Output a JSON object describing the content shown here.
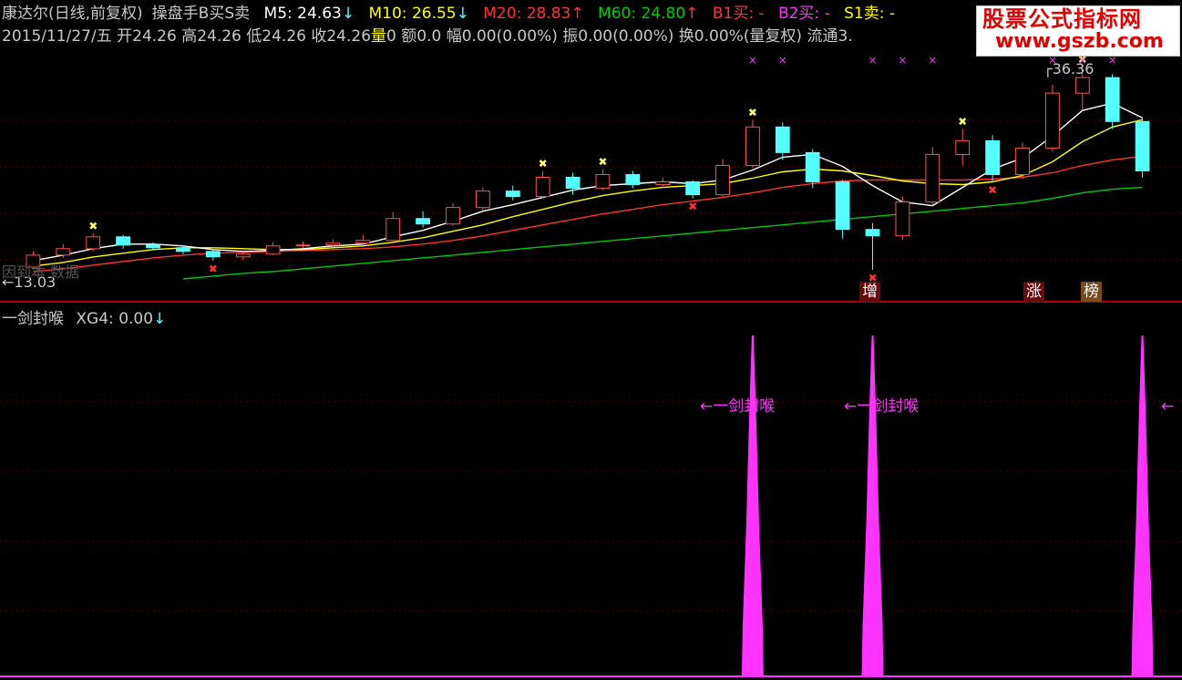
{
  "header": {
    "stock_name": "康达尔(日线,前复权)",
    "indicator_name": "操盘手B买S卖",
    "m5": {
      "label": "M5:",
      "value": "24.63",
      "arrow": "↓"
    },
    "m10": {
      "label": "M10:",
      "value": "26.55",
      "arrow": "↓"
    },
    "m20": {
      "label": "M20:",
      "value": "28.83",
      "arrow": "↑"
    },
    "m60": {
      "label": "M60:",
      "value": "24.80",
      "arrow": "↑"
    },
    "b1": "B1买: -",
    "b2": "B2买: -",
    "s1": "S1卖: -"
  },
  "info_line": {
    "date": "2015/11/27/五",
    "open": "开24.26",
    "high": "高24.26",
    "low": "低24.26",
    "close": "收24.26",
    "volume_label": "量",
    "volume_value": "0",
    "amount": "额0.0",
    "amplitude_pct": "幅0.00(0.00%)",
    "swing": "振0.00(0.00%)",
    "turnover": "换0.00%(量复权)",
    "float": "流通3."
  },
  "price_labels": {
    "high_value": "36.36",
    "low_value": "13.03",
    "low_arrow": "←",
    "faded_text": "因到本 数据"
  },
  "badges": {
    "zeng": "增",
    "zhang": "涨",
    "bang": "榜"
  },
  "indicator": {
    "title": "一剑封喉",
    "xg4_label": "XG4:",
    "xg4_value": "0.00",
    "xg4_arrow": "↓",
    "annotation": "←一剑封喉",
    "annotation_arrow": "←"
  },
  "watermark": {
    "line1": "股票公式指标网",
    "line2": "www.gszb.com"
  },
  "colors": {
    "m5": "#ffffff",
    "m10": "#ffff00",
    "m20": "#ff3333",
    "m60": "#00cc00",
    "b2": "#ff33ff",
    "up_candle": "#ff5050",
    "down_candle": "#54ffff",
    "signal": "#ff33ff",
    "grid": "#8b0000"
  },
  "chart_data": {
    "type": "line",
    "x_count": 38,
    "candles": [
      {
        "o": 14.5,
        "c": 15.8,
        "h": 16.2,
        "l": 14.2
      },
      {
        "o": 15.8,
        "c": 16.5,
        "h": 17.0,
        "l": 15.5
      },
      {
        "o": 16.5,
        "c": 17.8,
        "h": 18.2,
        "l": 16.2
      },
      {
        "o": 17.8,
        "c": 16.9,
        "h": 18.0,
        "l": 16.5
      },
      {
        "o": 16.9,
        "c": 16.6,
        "h": 17.2,
        "l": 16.3
      },
      {
        "o": 16.6,
        "c": 16.2,
        "h": 16.9,
        "l": 15.9
      },
      {
        "o": 16.2,
        "c": 15.6,
        "h": 16.4,
        "l": 15.2
      },
      {
        "o": 15.6,
        "c": 15.9,
        "h": 16.2,
        "l": 15.3
      },
      {
        "o": 15.9,
        "c": 16.8,
        "h": 17.2,
        "l": 15.8
      },
      {
        "o": 16.8,
        "c": 16.9,
        "h": 17.3,
        "l": 16.6
      },
      {
        "o": 16.9,
        "c": 17.1,
        "h": 17.5,
        "l": 16.7
      },
      {
        "o": 17.1,
        "c": 17.4,
        "h": 18.0,
        "l": 17.0
      },
      {
        "o": 17.4,
        "c": 19.8,
        "h": 20.5,
        "l": 17.3
      },
      {
        "o": 19.8,
        "c": 19.2,
        "h": 20.6,
        "l": 18.8
      },
      {
        "o": 19.2,
        "c": 21.0,
        "h": 21.5,
        "l": 19.0
      },
      {
        "o": 21.0,
        "c": 22.8,
        "h": 23.2,
        "l": 20.6
      },
      {
        "o": 22.8,
        "c": 22.2,
        "h": 23.4,
        "l": 21.8
      },
      {
        "o": 22.2,
        "c": 24.3,
        "h": 25.0,
        "l": 22.0
      },
      {
        "o": 24.3,
        "c": 23.1,
        "h": 24.8,
        "l": 22.4
      },
      {
        "o": 23.1,
        "c": 24.6,
        "h": 25.2,
        "l": 22.9
      },
      {
        "o": 24.6,
        "c": 23.5,
        "h": 25.0,
        "l": 23.1
      },
      {
        "o": 23.5,
        "c": 23.8,
        "h": 24.3,
        "l": 23.2
      },
      {
        "o": 23.8,
        "c": 22.4,
        "h": 24.0,
        "l": 22.0
      },
      {
        "o": 22.4,
        "c": 25.6,
        "h": 26.3,
        "l": 22.2
      },
      {
        "o": 25.6,
        "c": 29.8,
        "h": 30.6,
        "l": 25.3
      },
      {
        "o": 29.8,
        "c": 27.0,
        "h": 30.3,
        "l": 26.2
      },
      {
        "o": 27.0,
        "c": 23.8,
        "h": 27.4,
        "l": 23.1
      },
      {
        "o": 23.8,
        "c": 18.6,
        "h": 24.0,
        "l": 17.6
      },
      {
        "o": 18.6,
        "c": 17.9,
        "h": 19.3,
        "l": 14.2
      },
      {
        "o": 17.9,
        "c": 21.6,
        "h": 22.2,
        "l": 17.5
      },
      {
        "o": 21.6,
        "c": 26.8,
        "h": 27.6,
        "l": 21.2
      },
      {
        "o": 26.8,
        "c": 28.3,
        "h": 29.6,
        "l": 25.6
      },
      {
        "o": 28.3,
        "c": 24.6,
        "h": 28.9,
        "l": 23.8
      },
      {
        "o": 24.6,
        "c": 27.5,
        "h": 28.1,
        "l": 24.2
      },
      {
        "o": 27.5,
        "c": 33.5,
        "h": 34.4,
        "l": 27.1
      },
      {
        "o": 33.5,
        "c": 35.2,
        "h": 36.36,
        "l": 31.6
      },
      {
        "o": 35.2,
        "c": 30.4,
        "h": 35.6,
        "l": 29.6
      },
      {
        "o": 30.4,
        "c": 25.0,
        "h": 30.8,
        "l": 24.26
      }
    ],
    "m5": [
      15.2,
      15.8,
      16.5,
      17.0,
      17.0,
      16.8,
      16.4,
      16.2,
      16.3,
      16.5,
      16.8,
      17.0,
      17.8,
      18.5,
      19.5,
      20.6,
      21.3,
      22.1,
      22.9,
      23.4,
      23.6,
      23.8,
      23.6,
      24.0,
      25.1,
      26.5,
      26.8,
      25.5,
      23.4,
      21.6,
      21.2,
      23.2,
      25.2,
      26.4,
      28.8,
      31.6,
      32.4,
      30.8
    ],
    "m10": [
      14.6,
      15.0,
      15.6,
      16.0,
      16.4,
      16.6,
      16.6,
      16.5,
      16.4,
      16.4,
      16.6,
      16.8,
      17.2,
      17.7,
      18.4,
      19.1,
      20.0,
      20.8,
      21.6,
      22.3,
      22.8,
      23.2,
      23.4,
      23.6,
      24.2,
      24.9,
      25.2,
      25.0,
      24.5,
      23.9,
      23.6,
      23.5,
      23.8,
      24.5,
      26.0,
      28.2,
      29.8,
      30.6
    ],
    "m20": [
      14.0,
      14.3,
      14.7,
      15.1,
      15.5,
      15.8,
      16.0,
      16.1,
      16.2,
      16.3,
      16.4,
      16.5,
      16.7,
      17.0,
      17.4,
      17.9,
      18.5,
      19.1,
      19.7,
      20.3,
      20.8,
      21.3,
      21.7,
      22.1,
      22.6,
      23.2,
      23.6,
      23.9,
      24.0,
      24.0,
      24.0,
      24.0,
      24.1,
      24.3,
      24.8,
      25.6,
      26.2,
      26.6
    ],
    "m60": [
      null,
      null,
      null,
      null,
      null,
      13.2,
      13.5,
      13.8,
      14.0,
      14.3,
      14.6,
      14.9,
      15.2,
      15.5,
      15.8,
      16.1,
      16.4,
      16.7,
      17.0,
      17.3,
      17.6,
      17.9,
      18.2,
      18.5,
      18.8,
      19.1,
      19.4,
      19.7,
      20.0,
      20.3,
      20.6,
      20.9,
      21.2,
      21.5,
      22.0,
      22.6,
      23.0,
      23.2
    ],
    "signal_bars": [
      {
        "index": 24,
        "value": 1
      },
      {
        "index": 28,
        "value": 1
      },
      {
        "index": 37,
        "value": 1
      }
    ],
    "ylim": [
      12.0,
      37.5
    ],
    "signal_ylim": [
      0,
      1
    ]
  }
}
